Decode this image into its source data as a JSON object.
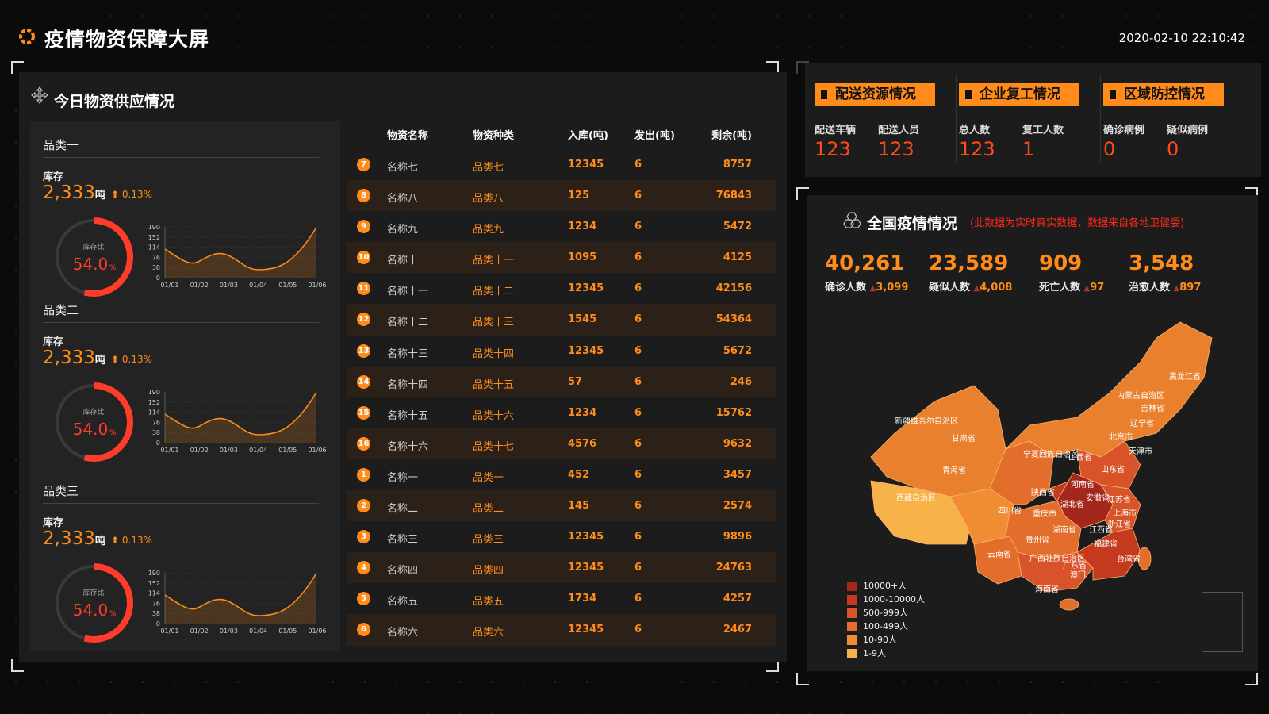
{
  "header": {
    "title": "疫情物资保障大屏",
    "datetime": "2020-02-10 22:10:42"
  },
  "supply": {
    "title": "今日物资供应情况",
    "categories": [
      {
        "name": "品类一",
        "stock_label": "库存",
        "stock_value": "2,333",
        "stock_unit": "吨",
        "stock_change": "0.13%",
        "gauge_label": "库存比",
        "gauge_value": "54.0",
        "gauge_unit": "%"
      },
      {
        "name": "品类二",
        "stock_label": "库存",
        "stock_value": "2,333",
        "stock_unit": "吨",
        "stock_change": "0.13%",
        "gauge_label": "库存比",
        "gauge_value": "54.0",
        "gauge_unit": "%"
      },
      {
        "name": "品类三",
        "stock_label": "库存",
        "stock_value": "2,333",
        "stock_unit": "吨",
        "stock_change": "0.13%",
        "gauge_label": "库存比",
        "gauge_value": "54.0",
        "gauge_unit": "%"
      }
    ],
    "gauge_ratio": 0.54,
    "mini_chart": {
      "type": "area",
      "x": [
        "01/01",
        "01/02",
        "01/03",
        "01/04",
        "01/05",
        "01/06"
      ],
      "y_ticks": [
        "190",
        "152",
        "114",
        "76",
        "38",
        "0"
      ]
    },
    "table": {
      "headers": [
        "物资名称",
        "物资种类",
        "入库(吨)",
        "发出(吨)",
        "剩余(吨)"
      ],
      "rows": [
        {
          "idx": "7",
          "name": "名称七",
          "type": "品类七",
          "in": "12345",
          "out": "6",
          "rem": "8757"
        },
        {
          "idx": "8",
          "name": "名称八",
          "type": "品类八",
          "in": "125",
          "out": "6",
          "rem": "76843"
        },
        {
          "idx": "9",
          "name": "名称九",
          "type": "品类九",
          "in": "1234",
          "out": "6",
          "rem": "5472"
        },
        {
          "idx": "10",
          "name": "名称十",
          "type": "品类十一",
          "in": "1095",
          "out": "6",
          "rem": "4125"
        },
        {
          "idx": "11",
          "name": "名称十一",
          "type": "品类十二",
          "in": "12345",
          "out": "6",
          "rem": "42156"
        },
        {
          "idx": "12",
          "name": "名称十二",
          "type": "品类十三",
          "in": "1545",
          "out": "6",
          "rem": "54364"
        },
        {
          "idx": "13",
          "name": "名称十三",
          "type": "品类十四",
          "in": "12345",
          "out": "6",
          "rem": "5672"
        },
        {
          "idx": "14",
          "name": "名称十四",
          "type": "品类十五",
          "in": "57",
          "out": "6",
          "rem": "246"
        },
        {
          "idx": "15",
          "name": "名称十五",
          "type": "品类十六",
          "in": "1234",
          "out": "6",
          "rem": "15762"
        },
        {
          "idx": "16",
          "name": "名称十六",
          "type": "品类十七",
          "in": "4576",
          "out": "6",
          "rem": "9632"
        },
        {
          "idx": "1",
          "name": "名称一",
          "type": "品类一",
          "in": "452",
          "out": "6",
          "rem": "3457"
        },
        {
          "idx": "2",
          "name": "名称二",
          "type": "品类二",
          "in": "145",
          "out": "6",
          "rem": "2574"
        },
        {
          "idx": "3",
          "name": "名称三",
          "type": "品类三",
          "in": "12345",
          "out": "6",
          "rem": "9896"
        },
        {
          "idx": "4",
          "name": "名称四",
          "type": "品类四",
          "in": "12345",
          "out": "6",
          "rem": "24763"
        },
        {
          "idx": "5",
          "name": "名称五",
          "type": "品类五",
          "in": "1734",
          "out": "6",
          "rem": "4257"
        },
        {
          "idx": "6",
          "name": "名称六",
          "type": "品类六",
          "in": "12345",
          "out": "6",
          "rem": "2467"
        }
      ]
    }
  },
  "info_groups": [
    {
      "title": "配送资源情况",
      "items": [
        {
          "label": "配送车辆",
          "value": "123"
        },
        {
          "label": "配送人员",
          "value": "123"
        }
      ]
    },
    {
      "title": "企业复工情况",
      "items": [
        {
          "label": "总人数",
          "value": "123"
        },
        {
          "label": "复工人数",
          "value": "1"
        }
      ]
    },
    {
      "title": "区域防控情况",
      "items": [
        {
          "label": "确诊病例",
          "value": "0"
        },
        {
          "label": "疑似病例",
          "value": "0"
        }
      ]
    }
  ],
  "epidemic": {
    "title": "全国疫情情况",
    "note": "(此数据为实时真实数据，数据来自各地卫健委)",
    "stats": [
      {
        "value": "40,261",
        "label": "确诊人数",
        "increase": "3,099"
      },
      {
        "value": "23,589",
        "label": "疑似人数",
        "increase": "4,008"
      },
      {
        "value": "909",
        "label": "死亡人数",
        "increase": "97"
      },
      {
        "value": "3,548",
        "label": "治愈人数",
        "increase": "897"
      }
    ],
    "legend": [
      {
        "label": "10000+人",
        "color": "#a3271b"
      },
      {
        "label": "1000-10000人",
        "color": "#c43a1f"
      },
      {
        "label": "500-999人",
        "color": "#d9532a"
      },
      {
        "label": "100-499人",
        "color": "#e36d2b"
      },
      {
        "label": "10-90人",
        "color": "#f08c33"
      },
      {
        "label": "1-9人",
        "color": "#f7b24a"
      }
    ],
    "provinces": [
      "黑龙江省",
      "内蒙古自治区",
      "吉林省",
      "辽宁省",
      "新疆维吾尔自治区",
      "甘肃省",
      "北京市",
      "天津市",
      "宁夏回族自治区",
      "山西省",
      "山东省",
      "青海省",
      "河南省",
      "陕西省",
      "江苏省",
      "西藏自治区",
      "四川省",
      "湖北省",
      "安徽省",
      "上海市",
      "重庆市",
      "浙江省",
      "湖南省",
      "江西省",
      "贵州省",
      "福建省",
      "云南省",
      "广西壮族自治区",
      "广东省",
      "台湾省",
      "澳门",
      "海南省"
    ]
  },
  "colors": {
    "accent": "#ff8c1a",
    "alert": "#ff4a1a",
    "note": "#ff2a1a"
  }
}
